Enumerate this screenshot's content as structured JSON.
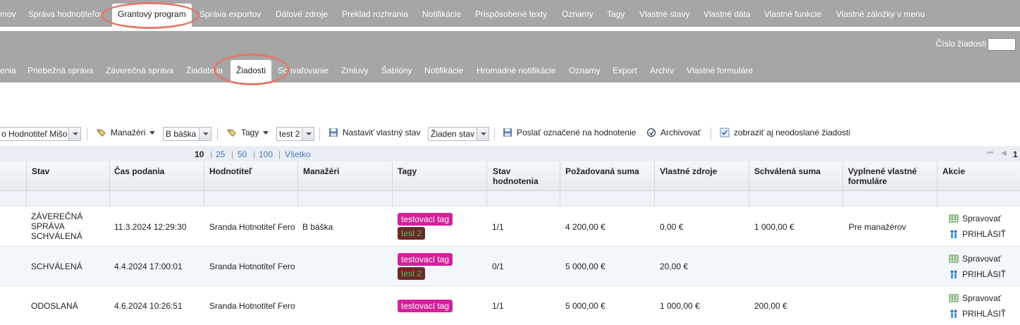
{
  "top_nav": {
    "items": [
      "mov",
      "Správa hodnotiteľov",
      "Grantový program",
      "Správa exportov",
      "Dátové zdroje",
      "Preklad rozhrania",
      "Notifikácie",
      "Prispôsobené texty",
      "Oznamy",
      "Tagy",
      "Vlastné stavy",
      "Vlastné dáta",
      "Vlastné funkcie",
      "Vlastné záložky v menu"
    ],
    "active": "Grantový program"
  },
  "search": {
    "label": "Číslo žiadosti",
    "value": ""
  },
  "sub_nav": {
    "items": [
      "enia",
      "Priebežná správa",
      "Záverečná správa",
      "Žiadatelia",
      "Žiadosti",
      "Schvaľovanie",
      "Zmluvy",
      "Šablóny",
      "Notifikácie",
      "Hromadné notifikácie",
      "Oznamy",
      "Export",
      "Archív",
      "Vlastné formuláre"
    ],
    "active": "Žiadosti"
  },
  "toolbar": {
    "evaluator_value": "o Hodnotiteľ Mišo",
    "managers_label": "Manažéri",
    "managers_value": "B báška",
    "tags_label": "Tagy",
    "tags_value": "test 2",
    "set_status_label": "Nastaviť vlastný stav",
    "status_value": "Žiaden stav",
    "send_label": "Poslať označené na hodnotenie",
    "archive_label": "Archivovať",
    "show_unsent_label": "zobraziť aj neodoslané žiadosti",
    "show_unsent_checked": true
  },
  "pager": {
    "sizes": [
      "10",
      "25",
      "50",
      "100",
      "Všetko"
    ],
    "active_size": "10",
    "page": "1"
  },
  "table": {
    "headers": {
      "stav": "Stav",
      "cas": "Čas podania",
      "hodnotitel": "Hodnotiteľ",
      "manazeri": "Manažéri",
      "tagy": "Tagy",
      "stav_hodnotenia_1": "Stav",
      "stav_hodnotenia_2": "hodnotenia",
      "pozadovana": "Požadovaná suma",
      "vlastne": "Vlastné zdroje",
      "schvalena": "Schválená suma",
      "vyplnene_1": "Vyplnené vlastné",
      "vyplnene_2": "formuláre",
      "akcie": "Akcie"
    },
    "rows": [
      {
        "stav_lines": [
          "ZÁVEREČNÁ",
          "SPRÁVA",
          "SCHVÁLENÁ"
        ],
        "cas": "11.3.2024 12:29:30",
        "hodnotitel": "Sranda Hotnotiteľ Fero",
        "manazeri": "B báška",
        "tags": [
          "testovací tag",
          "test 2"
        ],
        "stav_hodnotenia": "1/1",
        "pozadovana": "4 200,00 €",
        "vlastne": "0,00 €",
        "schvalena": "1 000,00 €",
        "vyplnene": "Pre manažérov",
        "action_manage": "Spravovať",
        "action_login": "PRIHLÁSIŤ"
      },
      {
        "stav_lines": [
          "SCHVÁLENÁ"
        ],
        "cas": "4.4.2024 17:00:01",
        "hodnotitel": "Sranda Hotnotiteľ Fero",
        "manazeri": "",
        "tags": [
          "testovací tag",
          "test 2"
        ],
        "stav_hodnotenia": "0/1",
        "pozadovana": "5 000,00 €",
        "vlastne": "20,00 €",
        "schvalena": "",
        "vyplnene": "",
        "action_manage": "Spravovať",
        "action_login": "PRIHLÁSIŤ"
      },
      {
        "stav_lines": [
          "ODOSLANÁ"
        ],
        "cas": "4.6.2024 10:26:51",
        "hodnotitel": "Sranda Hotnotiteľ Fero",
        "manazeri": "",
        "tags": [
          "testovací tag"
        ],
        "stav_hodnotenia": "1/1",
        "pozadovana": "5 000,00 €",
        "vlastne": "1 000,00 €",
        "schvalena": "200,00 €",
        "vyplnene": "",
        "action_manage": "Spravovať",
        "action_login": "PRIHLÁSIŤ"
      }
    ]
  },
  "colors": {
    "nav_bg": "#a6a6a6",
    "highlight_ellipse": "#e07a6e",
    "tag_pink": "#d4209b",
    "tag_brown": "#6b2a28",
    "link_blue": "#4a7bb7"
  }
}
